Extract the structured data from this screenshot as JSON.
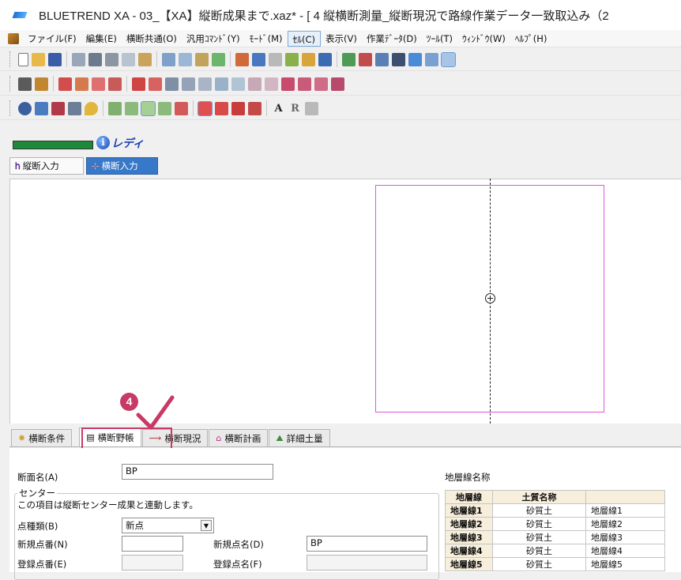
{
  "window": {
    "title": "BLUETREND XA - 03_【XA】縦断成果まで.xaz* - [ 4 縦横断測量_縦断現況で路線作業データ一致取込み（2"
  },
  "menu": {
    "items": [
      "ファイル(F)",
      "編集(E)",
      "横断共通(O)",
      "汎用ｺﾏﾝﾄﾞ(Y)",
      "ﾓｰﾄﾞ(M)",
      "ｾﾙ(C)",
      "表示(V)",
      "作業ﾃﾞｰﾀ(D)",
      "ﾂｰﾙ(T)",
      "ｳｨﾝﾄﾞｳ(W)",
      "ﾍﾙﾌﾟ(H)"
    ],
    "active_index": 5
  },
  "toolbar3": {
    "text_a": "A",
    "text_b": "R"
  },
  "status": {
    "text": "レディ",
    "progress_percent": 100,
    "info_glyph": "i"
  },
  "modes": {
    "longitudinal": "縦断入力",
    "cross": "横断入力"
  },
  "lower_tabs": [
    {
      "label": "横断条件",
      "icon": "gear-icon"
    },
    {
      "label": "横断野帳",
      "icon": "page-icon"
    },
    {
      "label": "横断現況",
      "icon": "terrain-icon"
    },
    {
      "label": "横断計画",
      "icon": "plan-icon"
    },
    {
      "label": "詳細土量",
      "icon": "earth-icon"
    }
  ],
  "annotation": {
    "step": "4"
  },
  "form": {
    "section_name_label": "断面名(A)",
    "section_name_value": "BP",
    "group_title": "センター",
    "group_note": "この項目は縦断センター成果と連動します。",
    "point_kind_label": "点種類(B)",
    "point_kind_value": "新点",
    "new_point_no_label": "新規点番(N)",
    "new_point_no_value": "",
    "new_point_name_label": "新規点名(D)",
    "new_point_name_value": "BP",
    "reg_point_no_label": "登録点番(E)",
    "reg_point_no_value": "",
    "reg_point_name_label": "登録点名(F)",
    "reg_point_name_value": ""
  },
  "strata": {
    "title": "地層線名称",
    "headers": [
      "地層線",
      "土質名称",
      ""
    ],
    "rows": [
      [
        "地層線1",
        "砂質土",
        "地層線1"
      ],
      [
        "地層線2",
        "砂質土",
        "地層線2"
      ],
      [
        "地層線3",
        "砂質土",
        "地層線3"
      ],
      [
        "地層線4",
        "砂質土",
        "地層線4"
      ],
      [
        "地層線5",
        "砂質土",
        "地層線5"
      ]
    ]
  },
  "colors": {
    "accent": "#3878c8",
    "annotation": "#c83a66",
    "frame": "#e254e2",
    "progress": "#1d8a3a"
  }
}
